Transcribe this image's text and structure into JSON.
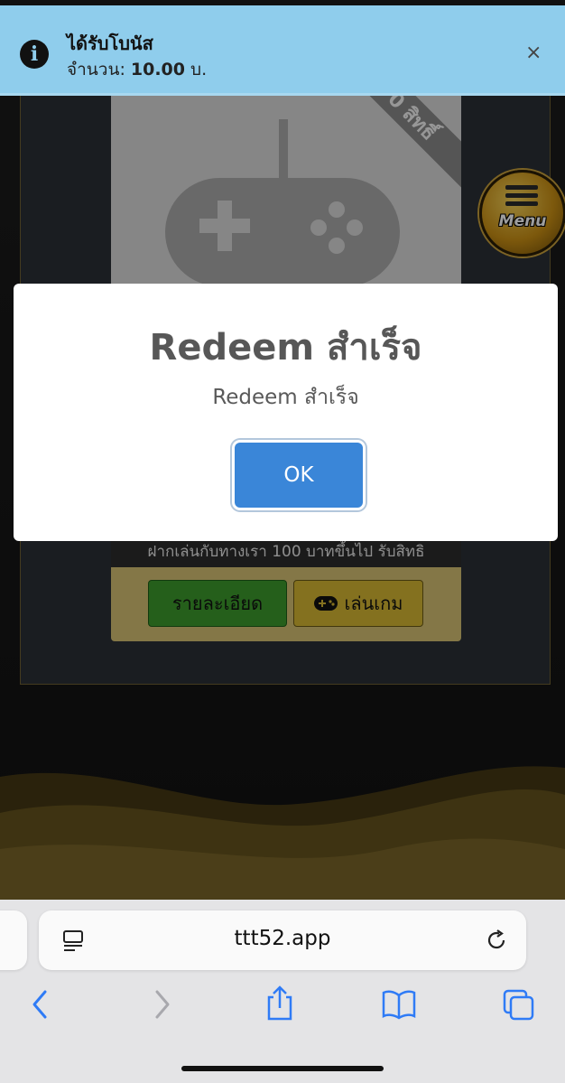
{
  "notification": {
    "title": "ได้รับโบนัส",
    "amount_prefix": "จำนวน: ",
    "amount": "10.00",
    "amount_suffix": " บ.",
    "close_glyph": "×"
  },
  "game_card": {
    "ribbon_text": "0 สิทธิ์",
    "description": "ฝากเล่นกับทางเรา 100 บาทขึ้นไป รับสิทธิ",
    "details_label": "รายละเอียด",
    "play_label": "เล่นเกม"
  },
  "menu_button": {
    "label": "Menu"
  },
  "modal": {
    "title": "Redeem สำเร็จ",
    "text": "Redeem สำเร็จ",
    "ok_label": "OK"
  },
  "browser": {
    "url": "ttt52.app",
    "toolbar": [
      "back",
      "forward",
      "share",
      "bookmarks",
      "tabs"
    ]
  },
  "colors": {
    "toast_bg": "#8fcdec",
    "ok_button": "#3a86d8",
    "details_button": "#3c9a2c",
    "play_button": "#d5b733",
    "ios_blue": "#2f7bf6"
  }
}
